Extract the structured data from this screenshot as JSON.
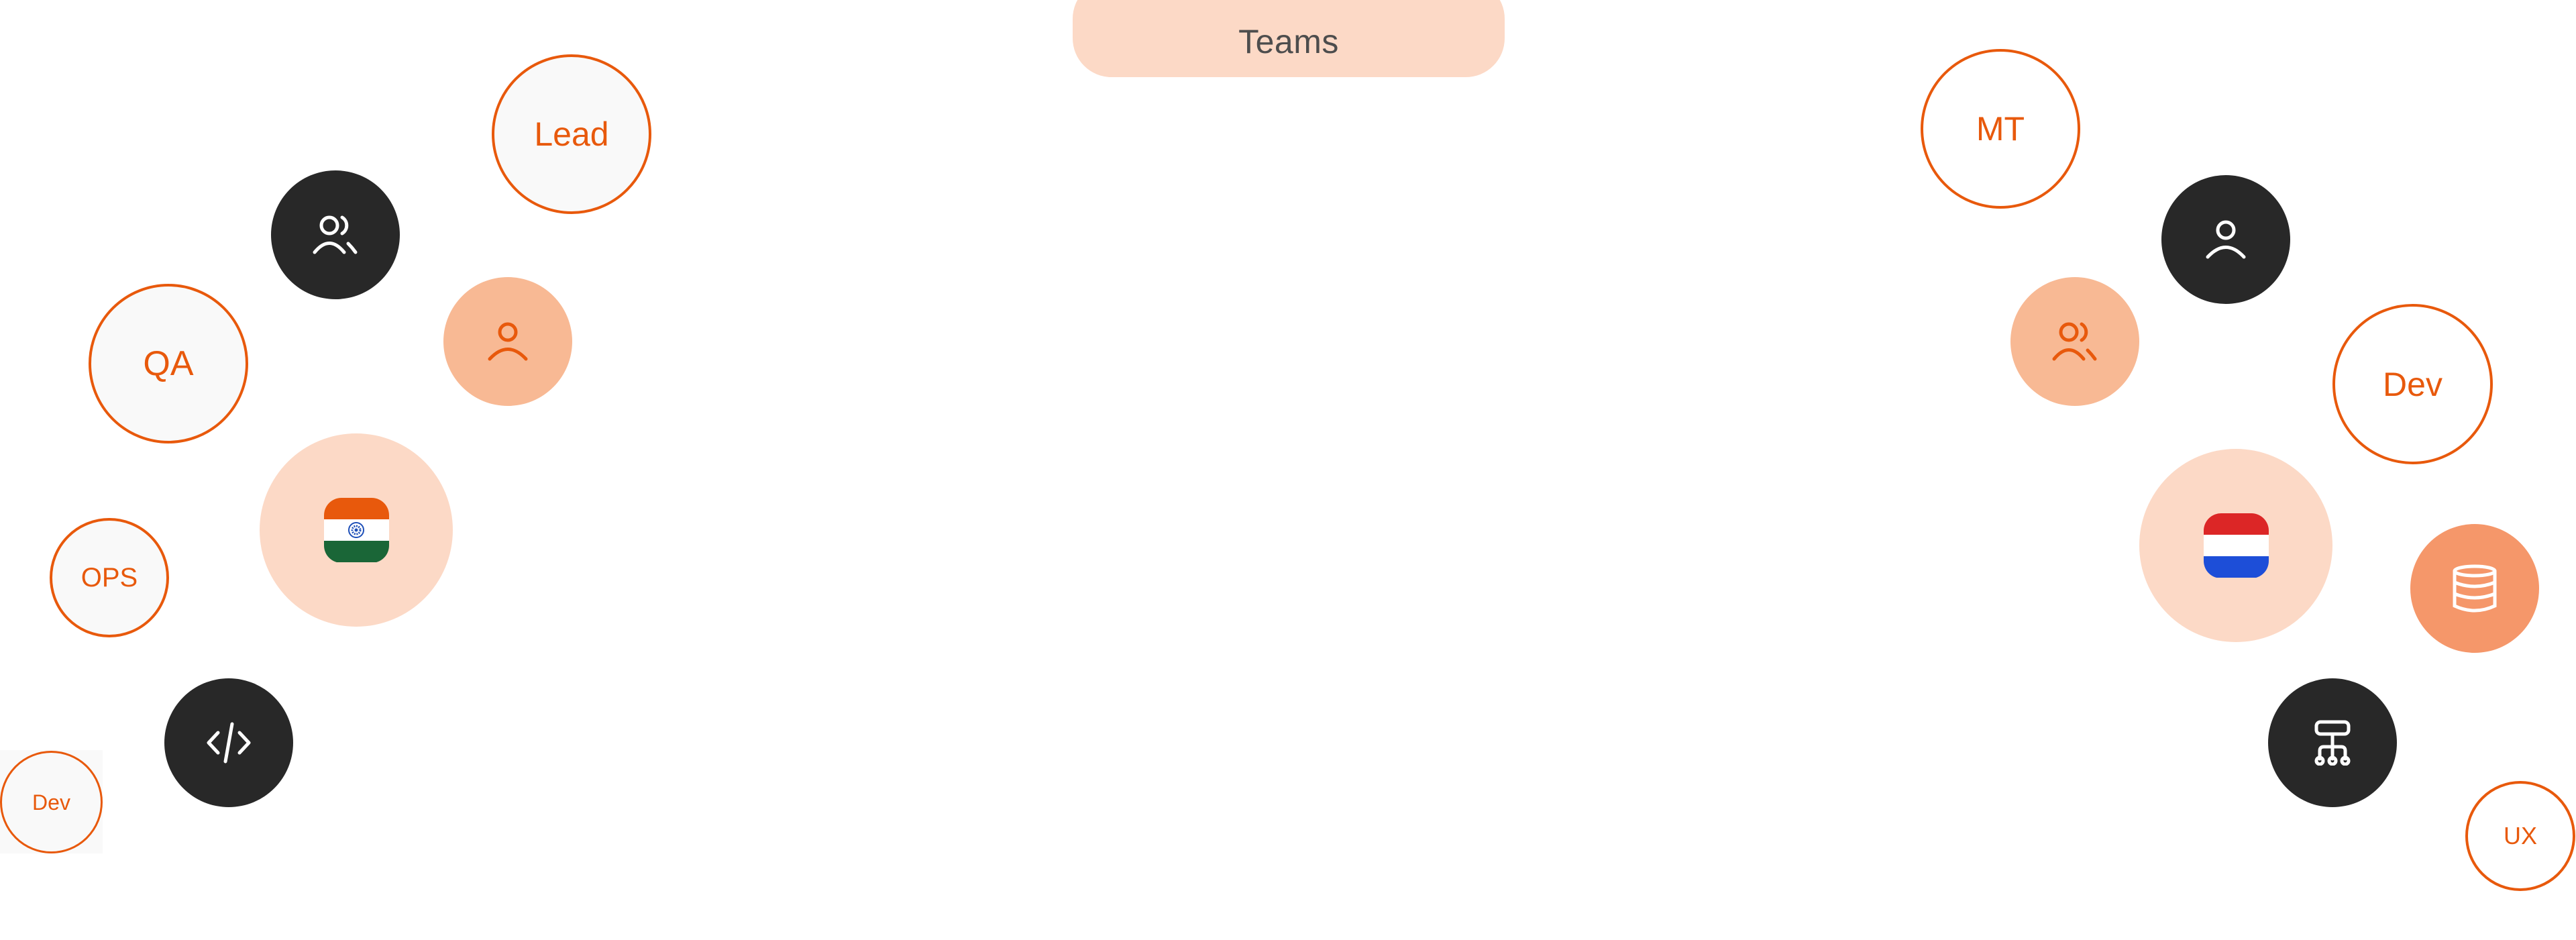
{
  "header": {
    "title": "Teams"
  },
  "colors": {
    "accent": "#e8590c",
    "dark": "#282828",
    "peach": "#f8b994",
    "coral": "#f5976a",
    "light_peach": "#fcd9c6",
    "text_gray": "#4d4d4d"
  },
  "left_cluster": {
    "country_flag": "india-flag-icon",
    "bubbles": [
      {
        "type": "label",
        "text": "Lead"
      },
      {
        "type": "icon",
        "icon": "users-icon"
      },
      {
        "type": "label",
        "text": "QA"
      },
      {
        "type": "icon",
        "icon": "user-icon"
      },
      {
        "type": "flag",
        "icon": "india-flag-icon"
      },
      {
        "type": "label",
        "text": "OPS"
      },
      {
        "type": "icon",
        "icon": "code-icon"
      },
      {
        "type": "label",
        "text": "Dev"
      }
    ]
  },
  "right_cluster": {
    "country_flag": "netherlands-flag-icon",
    "bubbles": [
      {
        "type": "label",
        "text": "MT"
      },
      {
        "type": "icon",
        "icon": "user-icon"
      },
      {
        "type": "icon",
        "icon": "users-icon"
      },
      {
        "type": "label",
        "text": "Dev"
      },
      {
        "type": "flag",
        "icon": "netherlands-flag-icon"
      },
      {
        "type": "icon",
        "icon": "database-icon"
      },
      {
        "type": "icon",
        "icon": "network-icon"
      },
      {
        "type": "label",
        "text": "UX"
      }
    ]
  }
}
